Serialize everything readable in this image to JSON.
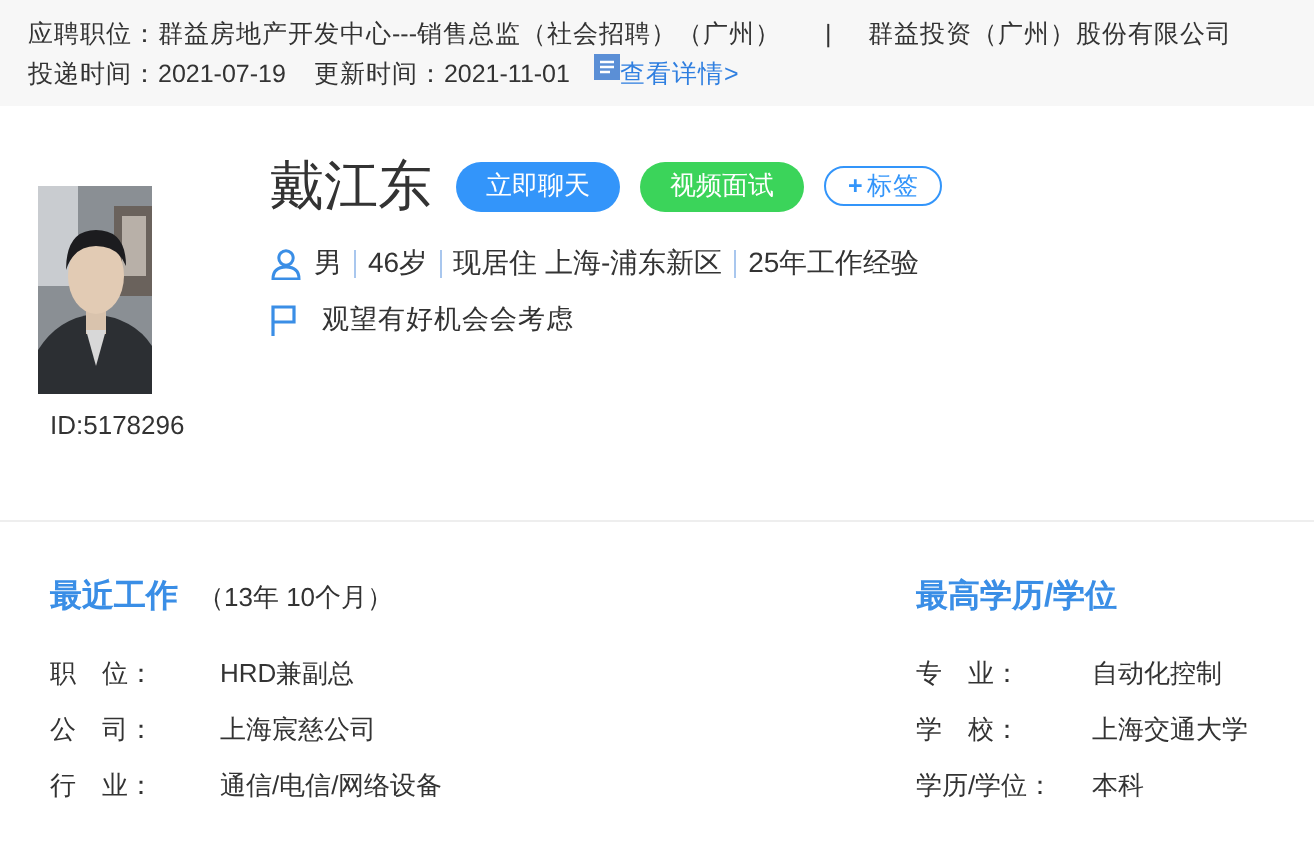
{
  "header": {
    "position_label": "应聘职位：",
    "position": "群益房地产开发中心---销售总监（社会招聘）（广州）",
    "separator": "|",
    "company": "群益投资（广州）股份有限公司",
    "delivered_label": "投递时间：",
    "delivered": "2021-07-19",
    "updated_label": "更新时间：",
    "updated": "2021-11-01",
    "details_link": "查看详情>"
  },
  "profile": {
    "id": "ID:5178296",
    "name": "戴江东",
    "buttons": [
      {
        "kind": "primary",
        "label": "立即聊天"
      },
      {
        "kind": "success",
        "label": "视频面试"
      },
      {
        "kind": "outline",
        "icon": "+",
        "label": "标签"
      }
    ],
    "facts": [
      "男",
      "46岁",
      "现居住 上海-浦东新区",
      "25年工作经验"
    ],
    "status": "观望有好机会会考虑"
  },
  "recent_work": {
    "title": "最近工作",
    "duration": "（13年 10个月）",
    "rows": [
      {
        "label": "职　位：",
        "value": "HRD兼副总"
      },
      {
        "label": "公　司：",
        "value": "上海宸慈公司"
      },
      {
        "label": "行　业：",
        "value": "通信/电信/网络设备"
      }
    ]
  },
  "education": {
    "title": "最高学历/学位",
    "rows": [
      {
        "label": "专　业：",
        "value": "自动化控制"
      },
      {
        "label": "学　校：",
        "value": "上海交通大学"
      },
      {
        "label": "学历/学位：",
        "value": "本科"
      }
    ]
  }
}
